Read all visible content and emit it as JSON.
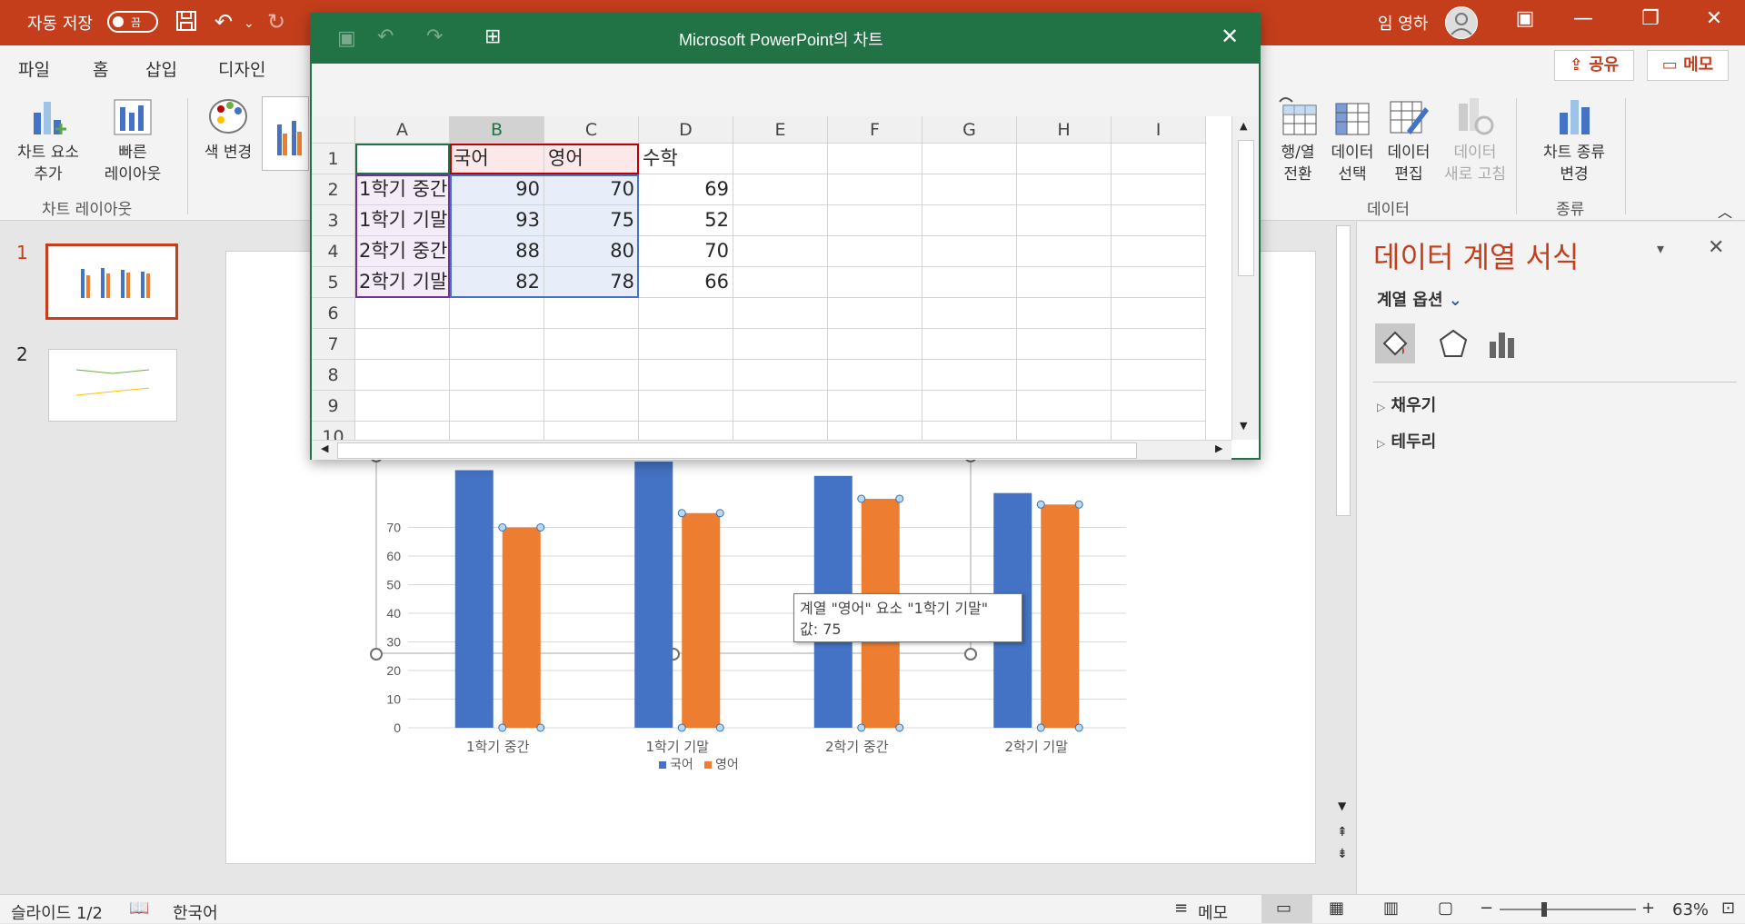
{
  "titlebar": {
    "autosave_label": "자동 저장",
    "autosave_state": "끔",
    "user_name": "임 영하"
  },
  "tabs": [
    "파일",
    "홈",
    "삽입",
    "디자인"
  ],
  "share_label": "공유",
  "memo_label": "메모",
  "ribbon": {
    "add_element": "차트 요소",
    "add_element2": "추가",
    "quick_layout": "빠른",
    "quick_layout2": "레이아웃",
    "change_color": "색 변경",
    "group_layout": "차트 레이아웃",
    "switch_rowcol": "행/열",
    "switch_rowcol2": "전환",
    "select_data": "데이터",
    "select_data2": "선택",
    "edit_data": "데이터",
    "edit_data2": "편집",
    "refresh_data": "데이터",
    "refresh_data2": "새로 고침",
    "group_data": "데이터",
    "change_type": "차트 종류",
    "change_type2": "변경",
    "group_type": "종류"
  },
  "slides": {
    "num1": "1",
    "num2": "2"
  },
  "excel": {
    "title": "Microsoft PowerPoint의 차트",
    "columns": [
      "A",
      "B",
      "C",
      "D",
      "E",
      "F",
      "G",
      "H",
      "I"
    ],
    "rows": [
      "1",
      "2",
      "3",
      "4",
      "5",
      "6",
      "7",
      "8",
      "9",
      "10"
    ],
    "header_row": [
      "",
      "국어",
      "영어",
      "수학"
    ],
    "data_rows": [
      [
        "1학기 중간",
        "90",
        "70",
        "69"
      ],
      [
        "1학기 기말",
        "93",
        "75",
        "52"
      ],
      [
        "2학기 중간",
        "88",
        "80",
        "70"
      ],
      [
        "2학기 기말",
        "82",
        "78",
        "66"
      ]
    ]
  },
  "chart_data": {
    "type": "bar",
    "categories": [
      "1학기 중간",
      "1학기 기말",
      "2학기 중간",
      "2학기 기말"
    ],
    "series": [
      {
        "name": "국어",
        "values": [
          90,
          93,
          88,
          82
        ],
        "color": "#4472c4"
      },
      {
        "name": "영어",
        "values": [
          70,
          75,
          80,
          78
        ],
        "color": "#ed7d31"
      }
    ],
    "ylim": [
      0,
      100
    ],
    "yticks": [
      0,
      10,
      20,
      30,
      40,
      50,
      60,
      70
    ],
    "legend": "bottom"
  },
  "tooltip": {
    "line1": "계열 \"영어\" 요소 \"1학기 기말\"",
    "line2": "값: 75"
  },
  "format_pane": {
    "title": "데이터 계열 서식",
    "options": "계열 옵션",
    "fill": "채우기",
    "border": "테두리"
  },
  "statusbar": {
    "slide": "슬라이드 1/2",
    "language": "한국어",
    "notes": "메모",
    "zoom": "63%"
  },
  "colors": {
    "accent": "#c43e1c",
    "excel_green": "#217346"
  }
}
